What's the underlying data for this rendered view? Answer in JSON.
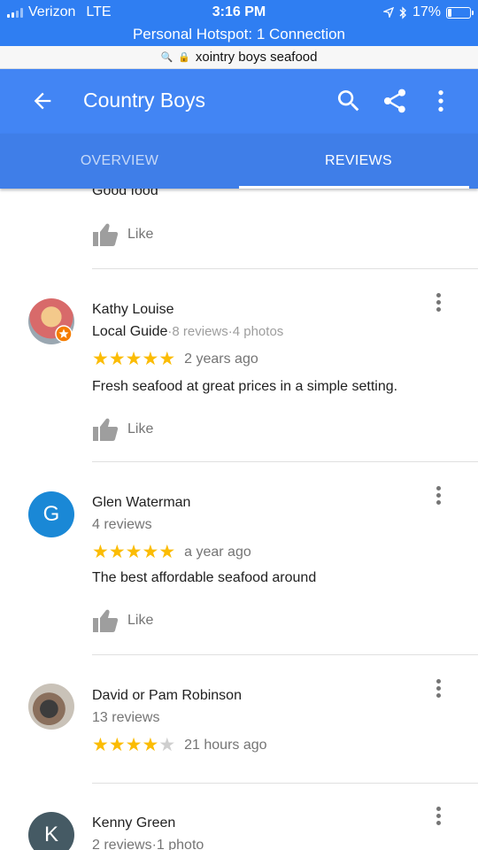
{
  "status": {
    "carrier": "Verizon",
    "network": "LTE",
    "time": "3:16 PM",
    "battery": "17%",
    "battery_fraction": 0.17
  },
  "hotspot": "Personal Hotspot: 1 Connection",
  "url": "xointry boys seafood",
  "appbar": {
    "title": "Country Boys"
  },
  "tabs": [
    {
      "label": "OVERVIEW"
    },
    {
      "label": "REVIEWS"
    }
  ],
  "partial_review": {
    "text": "Good food",
    "like_label": "Like"
  },
  "reviews": [
    {
      "name": "Kathy Louise",
      "guide": "Local Guide",
      "meta": "·8 reviews·4 photos",
      "rating": 5,
      "when": "2 years ago",
      "text": "Fresh seafood at great prices in a simple setting.",
      "like_label": "Like"
    },
    {
      "name": "Glen Waterman",
      "initial": "G",
      "meta": "4 reviews",
      "rating": 5,
      "when": "a year ago",
      "text": "The best affordable seafood around",
      "like_label": "Like",
      "avatar_color": "#1a88d6"
    },
    {
      "name": "David or Pam Robinson",
      "meta": "13 reviews",
      "rating": 4,
      "when": "21 hours ago"
    },
    {
      "name": "Kenny Green",
      "initial": "K",
      "meta": "2 reviews·1 photo",
      "avatar_color": "#455a64"
    }
  ],
  "colors": {
    "appbar": "#4285f4",
    "tabs": "#3f7ee8",
    "star": "#fbbc04"
  }
}
